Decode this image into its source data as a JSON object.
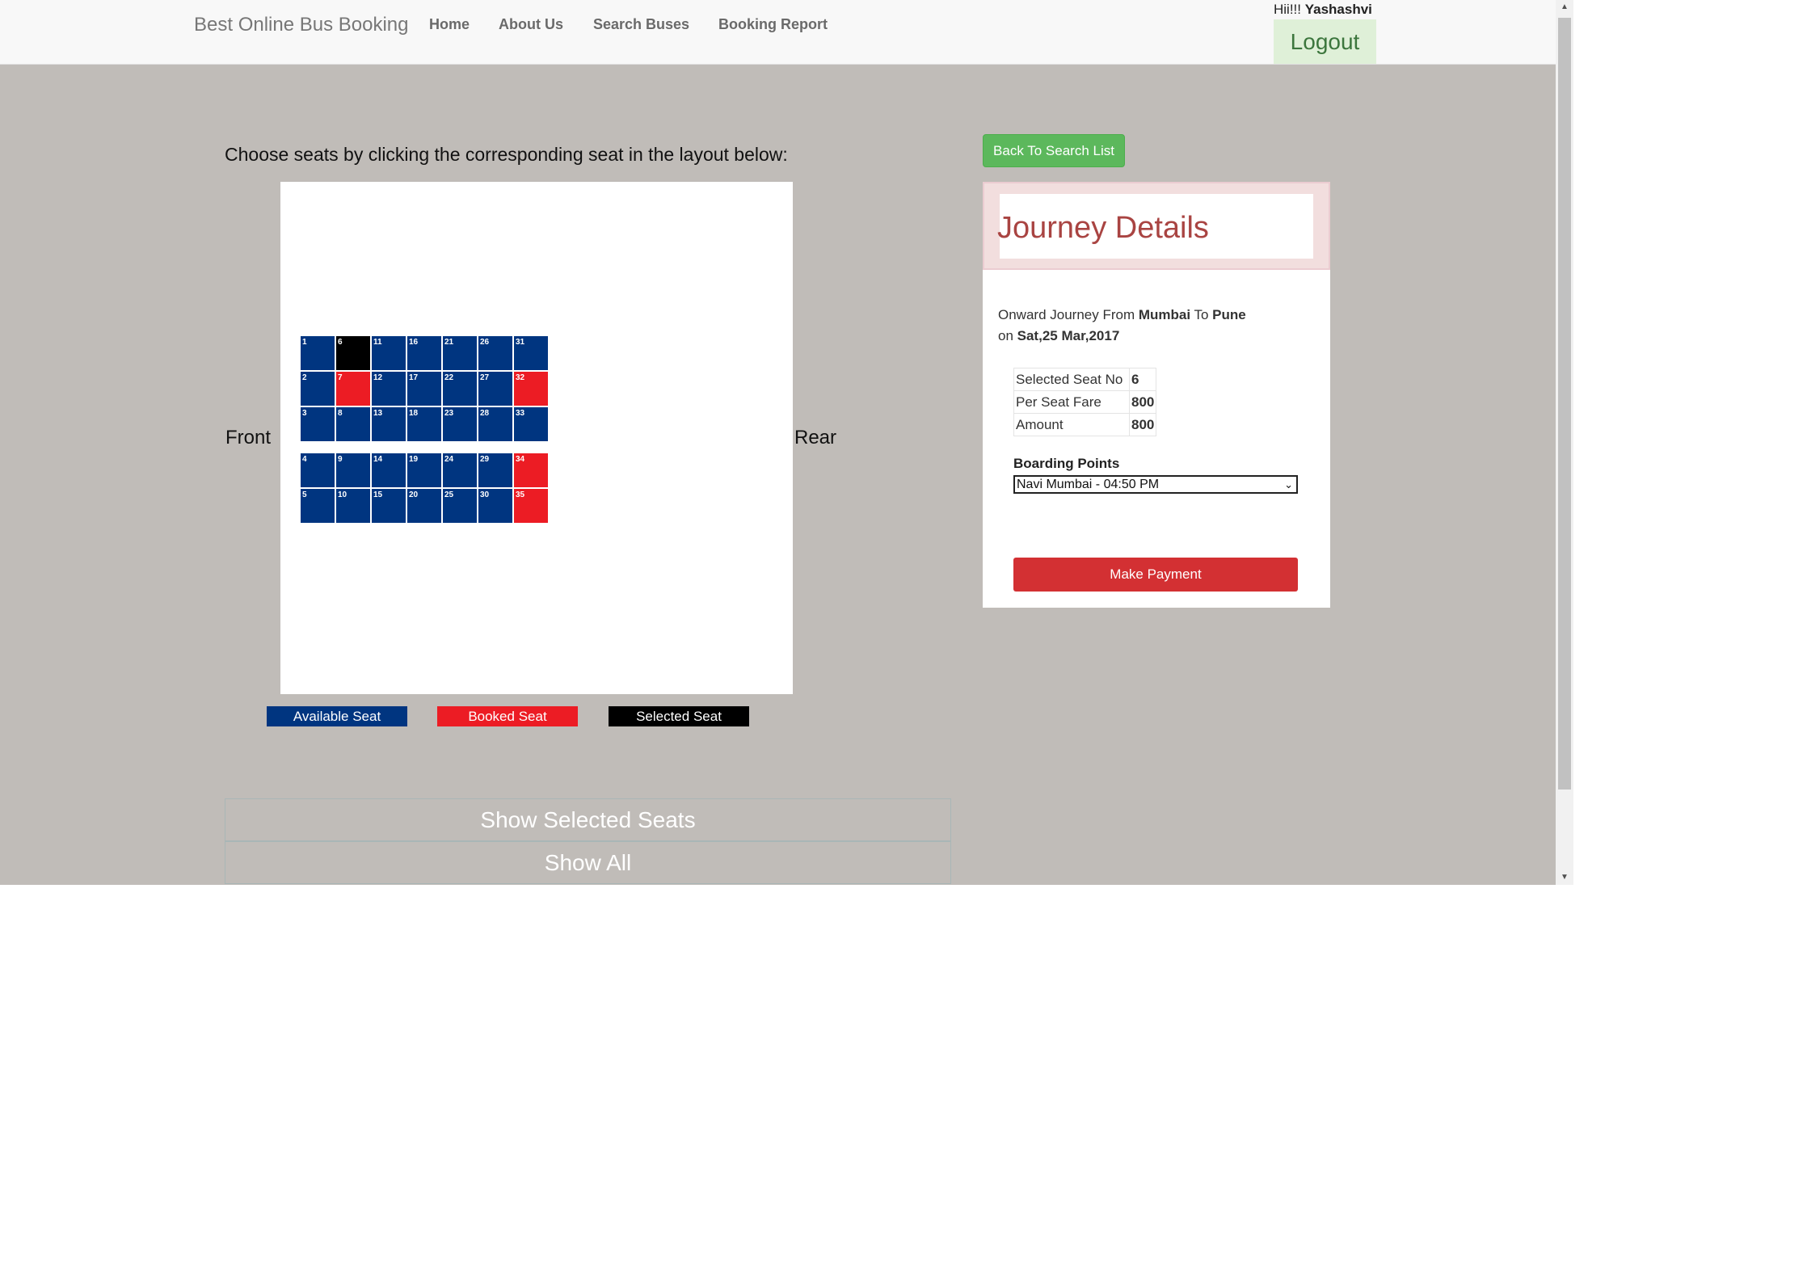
{
  "navbar": {
    "brand": "Best Online Bus Booking",
    "links": [
      "Home",
      "About Us",
      "Search Buses",
      "Booking Report"
    ],
    "greeting_prefix": "Hii!!! ",
    "username": "Yashashvi",
    "logout_label": "Logout"
  },
  "seat_layout": {
    "instruction": "Choose seats by clicking the corresponding seat in the layout below:",
    "front_label": "Front",
    "rear_label": "Rear",
    "seats": [
      {
        "no": "1",
        "status": "available"
      },
      {
        "no": "2",
        "status": "available"
      },
      {
        "no": "3",
        "status": "available"
      },
      {
        "no": "4",
        "status": "available"
      },
      {
        "no": "5",
        "status": "available"
      },
      {
        "no": "6",
        "status": "selected"
      },
      {
        "no": "7",
        "status": "booked"
      },
      {
        "no": "8",
        "status": "available"
      },
      {
        "no": "9",
        "status": "available"
      },
      {
        "no": "10",
        "status": "available"
      },
      {
        "no": "11",
        "status": "available"
      },
      {
        "no": "12",
        "status": "available"
      },
      {
        "no": "13",
        "status": "available"
      },
      {
        "no": "14",
        "status": "available"
      },
      {
        "no": "15",
        "status": "available"
      },
      {
        "no": "16",
        "status": "available"
      },
      {
        "no": "17",
        "status": "available"
      },
      {
        "no": "18",
        "status": "available"
      },
      {
        "no": "19",
        "status": "available"
      },
      {
        "no": "20",
        "status": "available"
      },
      {
        "no": "21",
        "status": "available"
      },
      {
        "no": "22",
        "status": "available"
      },
      {
        "no": "23",
        "status": "available"
      },
      {
        "no": "24",
        "status": "available"
      },
      {
        "no": "25",
        "status": "available"
      },
      {
        "no": "26",
        "status": "available"
      },
      {
        "no": "27",
        "status": "available"
      },
      {
        "no": "28",
        "status": "available"
      },
      {
        "no": "29",
        "status": "available"
      },
      {
        "no": "30",
        "status": "available"
      },
      {
        "no": "31",
        "status": "available"
      },
      {
        "no": "32",
        "status": "booked"
      },
      {
        "no": "33",
        "status": "available"
      },
      {
        "no": "34",
        "status": "booked"
      },
      {
        "no": "35",
        "status": "booked"
      }
    ]
  },
  "legend": {
    "available": "Available Seat",
    "booked": "Booked Seat",
    "selected": "Selected Seat"
  },
  "colors": {
    "available": "#003580",
    "booked": "#ec1c24",
    "selected": "#000000",
    "page_background": "#c0bcb8"
  },
  "buttons": {
    "show_selected": "Show Selected Seats",
    "show_all": "Show All",
    "back_to_search": "Back To Search List",
    "make_payment": "Make Payment"
  },
  "journey": {
    "title": "Journey Details",
    "prefix": "Onward Journey From ",
    "from": "Mumbai",
    "to_word": " To ",
    "to": "Pune",
    "on_word": "on ",
    "date": "Sat,25 Mar,2017",
    "details": [
      {
        "label": "Selected Seat No",
        "value": "6"
      },
      {
        "label": "Per Seat Fare",
        "value": "800"
      },
      {
        "label": "Amount",
        "value": "800"
      }
    ],
    "boarding_label": "Boarding Points",
    "boarding_selected": "Navi Mumbai - 04:50 PM"
  }
}
